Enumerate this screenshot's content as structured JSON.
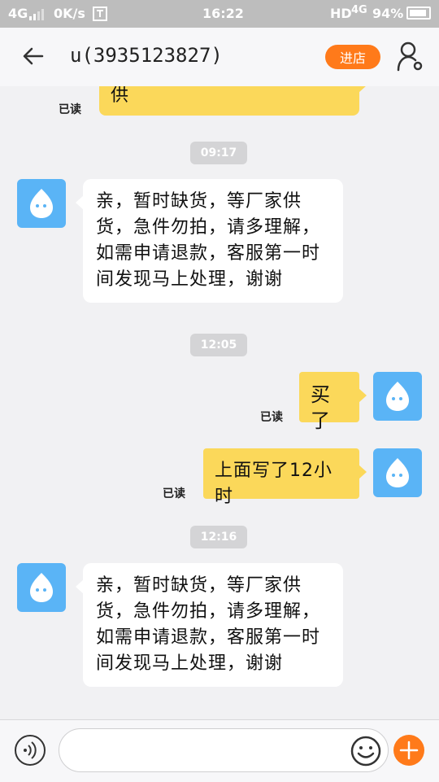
{
  "status_bar": {
    "network": "4G",
    "speed": "0K/s",
    "time": "16:22",
    "hd": "HD",
    "network_right": "4G",
    "battery": "94%"
  },
  "header": {
    "title": "u(3935123827)",
    "enter_store": "进店"
  },
  "messages": {
    "top_partial": {
      "text": "供",
      "read": "已读"
    },
    "time_1": "09:17",
    "msg_1": "亲，暂时缺货，等厂家供货，急件勿拍，请多理解，如需申请退款，客服第一时间发现马上处理，谢谢",
    "time_2": "12:05",
    "msg_2": {
      "text": "买了",
      "read": "已读"
    },
    "msg_3": {
      "text": "上面写了12小时",
      "read": "已读"
    },
    "time_3": "12:16",
    "msg_4": "亲，暂时缺货，等厂家供货，急件勿拍，请多理解，如需申请退款，客服第一时间发现马上处理，谢谢"
  },
  "input_bar": {
    "placeholder": ""
  },
  "icons": {
    "back": "arrow-left-icon",
    "profile": "user-settings-icon",
    "avatar": "droplet-mascot-icon",
    "voice": "voice-wave-icon",
    "emoji": "smiley-icon",
    "plus": "plus-icon"
  },
  "colors": {
    "accent": "#ff7a1a",
    "bubble_sent": "#fbd85a",
    "bubble_received": "#ffffff",
    "avatar_bg": "#5ab4f6",
    "background": "#f1f1f3"
  }
}
